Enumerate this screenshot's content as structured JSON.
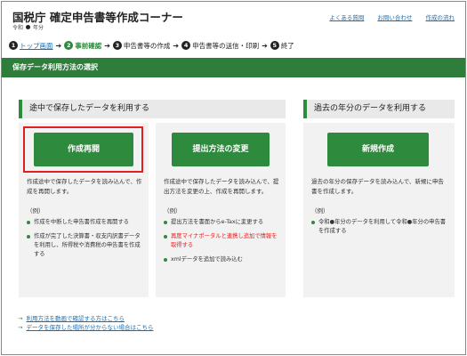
{
  "header": {
    "title": "国税庁 確定申告書等作成コーナー",
    "era": "令和",
    "year": "年分",
    "links": [
      "よくある質問",
      "お問い合わせ",
      "作成の流れ"
    ]
  },
  "steps": [
    {
      "num": "1",
      "label": "トップ画面"
    },
    {
      "num": "2",
      "label": "事前確認"
    },
    {
      "num": "3",
      "label": "申告書等の作成"
    },
    {
      "num": "4",
      "label": "申告書等の送信・印刷"
    },
    {
      "num": "5",
      "label": "終了"
    }
  ],
  "banner": "保存データ利用方法の選択",
  "sections": {
    "left_title": "途中で保存したデータを利用する",
    "right_title": "過去の年分のデータを利用する"
  },
  "cards": [
    {
      "button": "作成再開",
      "desc": "作成途中で保存したデータを読み込んで、作成を再開します。",
      "example_label": "（例）",
      "bullets": [
        "作成を中断した申告書作成を再開する",
        "作成が完了した決算書・収支内訳書データを利用し、所得税や消費税の申告書を作成する"
      ]
    },
    {
      "button": "提出方法の変更",
      "desc": "作成途中で保存したデータを読み込んで、提出方法を変更の上、作成を再開します。",
      "example_label": "（例）",
      "bullets": [
        "提出方法を書面からe-Taxに変更する",
        "再度マイナポータルと連携し追加で情報を取得する",
        "xmlデータを追加で読み込む"
      ]
    },
    {
      "button": "新規作成",
      "desc": "過去の年分の保存データを読み込んで、新規に申告書を作成します。",
      "example_label": "（例）",
      "bullets": [
        "令和●年分のデータを利用して令和●年分の申告書を作成する"
      ]
    }
  ],
  "footer_links": [
    "利用方法を動画で確認する方はこちら",
    "データを保存した場所が分からない場合はこちら"
  ],
  "colors": {
    "accent_green": "#2e8a3c",
    "banner_green": "#2e7d3a",
    "highlight_red": "#e02020",
    "link_blue": "#1a6fb5"
  }
}
